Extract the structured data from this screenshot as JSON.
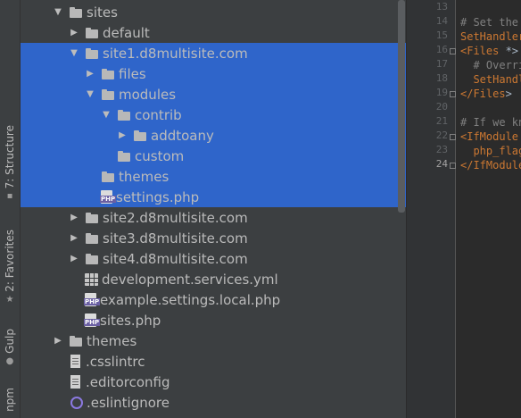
{
  "tool_strip": {
    "tabs": [
      {
        "label": "7: Structure",
        "icon": "structure-icon"
      },
      {
        "label": "2: Favorites",
        "icon": "star-icon"
      },
      {
        "label": "Gulp",
        "icon": "gulp-icon"
      },
      {
        "label": "npm",
        "icon": "npm-icon"
      }
    ]
  },
  "tree": {
    "items": [
      {
        "label": "sites",
        "type": "folder",
        "expanded": true,
        "depth": 0,
        "selected": false
      },
      {
        "label": "default",
        "type": "folder",
        "expanded": false,
        "depth": 1,
        "selected": false
      },
      {
        "label": "site1.d8multisite.com",
        "type": "folder",
        "expanded": true,
        "depth": 1,
        "selected": true
      },
      {
        "label": "files",
        "type": "folder",
        "expanded": false,
        "depth": 2,
        "selected": true
      },
      {
        "label": "modules",
        "type": "folder",
        "expanded": true,
        "depth": 2,
        "selected": true
      },
      {
        "label": "contrib",
        "type": "folder",
        "expanded": true,
        "depth": 3,
        "selected": true
      },
      {
        "label": "addtoany",
        "type": "folder",
        "expanded": false,
        "depth": 4,
        "selected": true
      },
      {
        "label": "custom",
        "type": "folder",
        "expanded": null,
        "depth": 3,
        "selected": true
      },
      {
        "label": "themes",
        "type": "folder",
        "expanded": null,
        "depth": 2,
        "selected": true
      },
      {
        "label": "settings.php",
        "type": "php",
        "expanded": null,
        "depth": 2,
        "selected": true
      },
      {
        "label": "site2.d8multisite.com",
        "type": "folder",
        "expanded": false,
        "depth": 1,
        "selected": false
      },
      {
        "label": "site3.d8multisite.com",
        "type": "folder",
        "expanded": false,
        "depth": 1,
        "selected": false
      },
      {
        "label": "site4.d8multisite.com",
        "type": "folder",
        "expanded": false,
        "depth": 1,
        "selected": false
      },
      {
        "label": "development.services.yml",
        "type": "yml",
        "expanded": null,
        "depth": 1,
        "selected": false
      },
      {
        "label": "example.settings.local.php",
        "type": "php",
        "expanded": null,
        "depth": 1,
        "selected": false
      },
      {
        "label": "sites.php",
        "type": "php",
        "expanded": null,
        "depth": 1,
        "selected": false
      },
      {
        "label": "themes",
        "type": "folder",
        "expanded": false,
        "depth": 0,
        "selected": false
      },
      {
        "label": ".csslintrc",
        "type": "text",
        "expanded": null,
        "depth": 0,
        "selected": false
      },
      {
        "label": ".editorconfig",
        "type": "text",
        "expanded": null,
        "depth": 0,
        "selected": false
      },
      {
        "label": ".eslintignore",
        "type": "eslint",
        "expanded": null,
        "depth": 0,
        "selected": false
      }
    ]
  },
  "editor": {
    "line_numbers": [
      "13",
      "14",
      "15",
      "16",
      "17",
      "18",
      "19",
      "20",
      "21",
      "22",
      "23",
      "24"
    ],
    "current_line": "24",
    "lines": [
      {
        "text": "",
        "kind": "plain"
      },
      {
        "text": "# Set the",
        "kind": "comment"
      },
      {
        "text": "SetHandler",
        "kind": "keyword"
      },
      {
        "text": "<Files *>",
        "kind": "mixed"
      },
      {
        "text": "  # Overri",
        "kind": "comment"
      },
      {
        "text": "  SetHandl",
        "kind": "keyword"
      },
      {
        "text": "</Files>",
        "kind": "mixed"
      },
      {
        "text": "",
        "kind": "plain"
      },
      {
        "text": "# If we kn",
        "kind": "comment"
      },
      {
        "text": "<IfModule",
        "kind": "keyword"
      },
      {
        "text": "  php_flag",
        "kind": "keyword"
      },
      {
        "text": "</IfModule",
        "kind": "keyword"
      }
    ]
  }
}
